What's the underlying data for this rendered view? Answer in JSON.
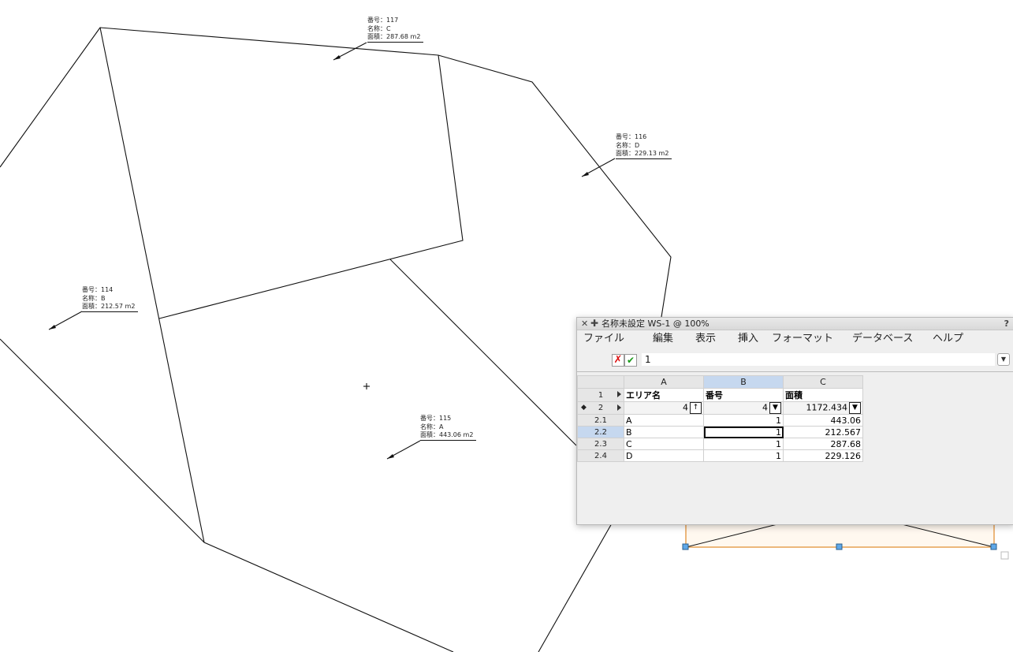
{
  "labels": [
    {
      "id": "117",
      "lines": [
        "番号：117",
        "名称：C",
        "面積：287.68 m2"
      ]
    },
    {
      "id": "116",
      "lines": [
        "番号：116",
        "名称：D",
        "面積：229.13 m2"
      ]
    },
    {
      "id": "114",
      "lines": [
        "番号：114",
        "名称：B",
        "面積：212.57 m2"
      ]
    },
    {
      "id": "115",
      "lines": [
        "番号：115",
        "名称：A",
        "面積：443.06 m2"
      ]
    }
  ],
  "worksheet": {
    "title": "名称未設定 WS-1 @ 100%",
    "help": "?",
    "menu": [
      "ファイル",
      "編集",
      "表示",
      "挿入",
      "フォーマット",
      "データベース",
      "ヘルプ"
    ],
    "formula_value": "1",
    "columns": [
      "A",
      "B",
      "C"
    ],
    "header_row": {
      "label": "1",
      "cells": [
        "エリア名",
        "番号",
        "面積"
      ]
    },
    "summary_row": {
      "label": "2",
      "cells": [
        "4",
        "4",
        "1172.434"
      ]
    },
    "rows": [
      {
        "label": "2.1",
        "name": "A",
        "num": "1",
        "area": "443.06"
      },
      {
        "label": "2.2",
        "name": "B",
        "num": "1",
        "area": "212.567"
      },
      {
        "label": "2.3",
        "name": "C",
        "num": "1",
        "area": "287.68"
      },
      {
        "label": "2.4",
        "name": "D",
        "num": "1",
        "area": "229.126"
      }
    ]
  },
  "colors": {
    "selection": "#c6d8ef",
    "handle": "#5fa8e8",
    "frame": "#e08a2a"
  }
}
